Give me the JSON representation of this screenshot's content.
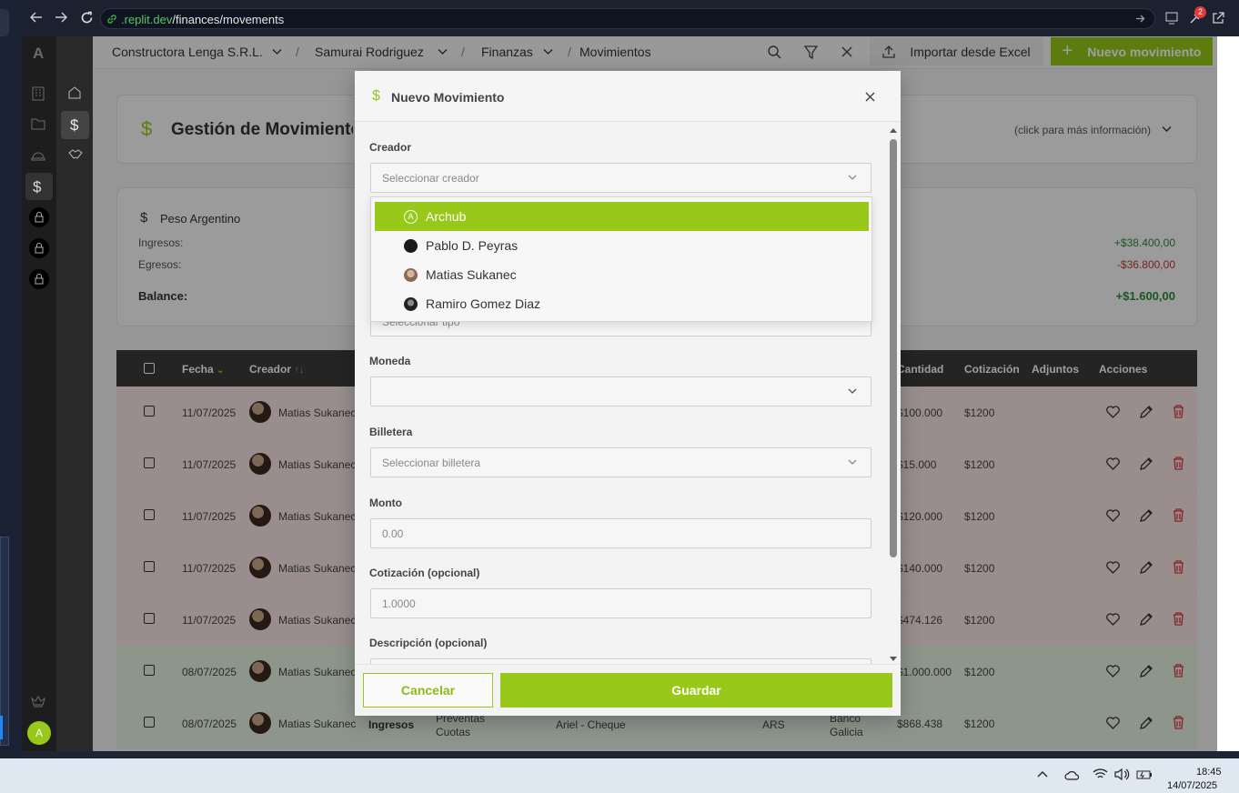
{
  "browser": {
    "url_domain": ".replit.dev",
    "url_path": "/finances/movements",
    "notif_count": "2"
  },
  "breadcrumb": {
    "org": "Constructora Lenga S.R.L.",
    "user": "Samurai Rodriguez",
    "section": "Finanzas",
    "page": "Movimientos",
    "separator": "/"
  },
  "toolbar": {
    "import_label": "Importar desde Excel",
    "new_label": "Nuevo movimiento"
  },
  "header_card": {
    "title": "Gestión de Movimientos",
    "info_link": "(click para más información)"
  },
  "summary": {
    "currency": "Peso Argentino",
    "income_label": "Ingresos:",
    "income_value": "+$38.400,00",
    "expense_label": "Egresos:",
    "expense_value": "-$36.800,00",
    "balance_label": "Balance:",
    "balance_value": "+$1.600,00"
  },
  "table": {
    "headers": {
      "fecha": "Fecha",
      "creador": "Creador",
      "cantidad": "Cantidad",
      "cotizacion": "Cotización",
      "adjuntos": "Adjuntos",
      "acciones": "Acciones"
    },
    "rows": [
      {
        "fecha": "11/07/2025",
        "creador": "Matias Sukanec",
        "cantidad": "$100.000",
        "cotizacion": "$1200",
        "kind": "expense"
      },
      {
        "fecha": "11/07/2025",
        "creador": "Matias Sukanec",
        "cantidad": "$15.000",
        "cotizacion": "$1200",
        "kind": "expense"
      },
      {
        "fecha": "11/07/2025",
        "creador": "Matias Sukanec",
        "cantidad": "$120.000",
        "cotizacion": "$1200",
        "kind": "expense"
      },
      {
        "fecha": "11/07/2025",
        "creador": "Matias Sukanec",
        "cantidad": "$140.000",
        "cotizacion": "$1200",
        "kind": "expense"
      },
      {
        "fecha": "11/07/2025",
        "creador": "Matias Sukanec",
        "cantidad": "$474.126",
        "cotizacion": "$1200",
        "kind": "expense"
      },
      {
        "fecha": "08/07/2025",
        "creador": "Matias Sukanec",
        "cantidad": "$1.000.000",
        "cotizacion": "$1200",
        "kind": "income"
      },
      {
        "fecha": "08/07/2025",
        "creador": "Matias Sukanec",
        "tipo": "Ingresos",
        "categoria1": "Preventas",
        "categoria2": "Cuotas",
        "descripcion": "Ariel - Cheque",
        "moneda": "ARS",
        "billetera1": "Banco",
        "billetera2": "Galicia",
        "cantidad": "$868.438",
        "cotizacion": "$1200",
        "kind": "income"
      }
    ]
  },
  "modal": {
    "title": "Nuevo Movimiento",
    "creador_label": "Creador",
    "creador_placeholder": "Seleccionar creador",
    "tipo_placeholder": "Seleccionar tipo",
    "moneda_label": "Moneda",
    "billetera_label": "Billetera",
    "billetera_placeholder": "Seleccionar billetera",
    "monto_label": "Monto",
    "monto_placeholder": "0.00",
    "cotizacion_label": "Cotización (opcional)",
    "cotizacion_placeholder": "1.0000",
    "descripcion_label": "Descripción (opcional)",
    "cancel_label": "Cancelar",
    "save_label": "Guardar"
  },
  "dropdown_options": [
    {
      "label": "Archub",
      "selected": true
    },
    {
      "label": "Pablo D. Peyras",
      "selected": false
    },
    {
      "label": "Matias Sukanec",
      "selected": false
    },
    {
      "label": "Ramiro Gomez Diaz",
      "selected": false
    }
  ],
  "sidebar": {
    "logo": "A",
    "avatar_initial": "A"
  },
  "taskbar": {
    "time": "18:45",
    "date": "14/07/2025"
  },
  "colors": {
    "accent": "#97c81a",
    "income": "#2e8b3a",
    "expense": "#c0392b"
  }
}
